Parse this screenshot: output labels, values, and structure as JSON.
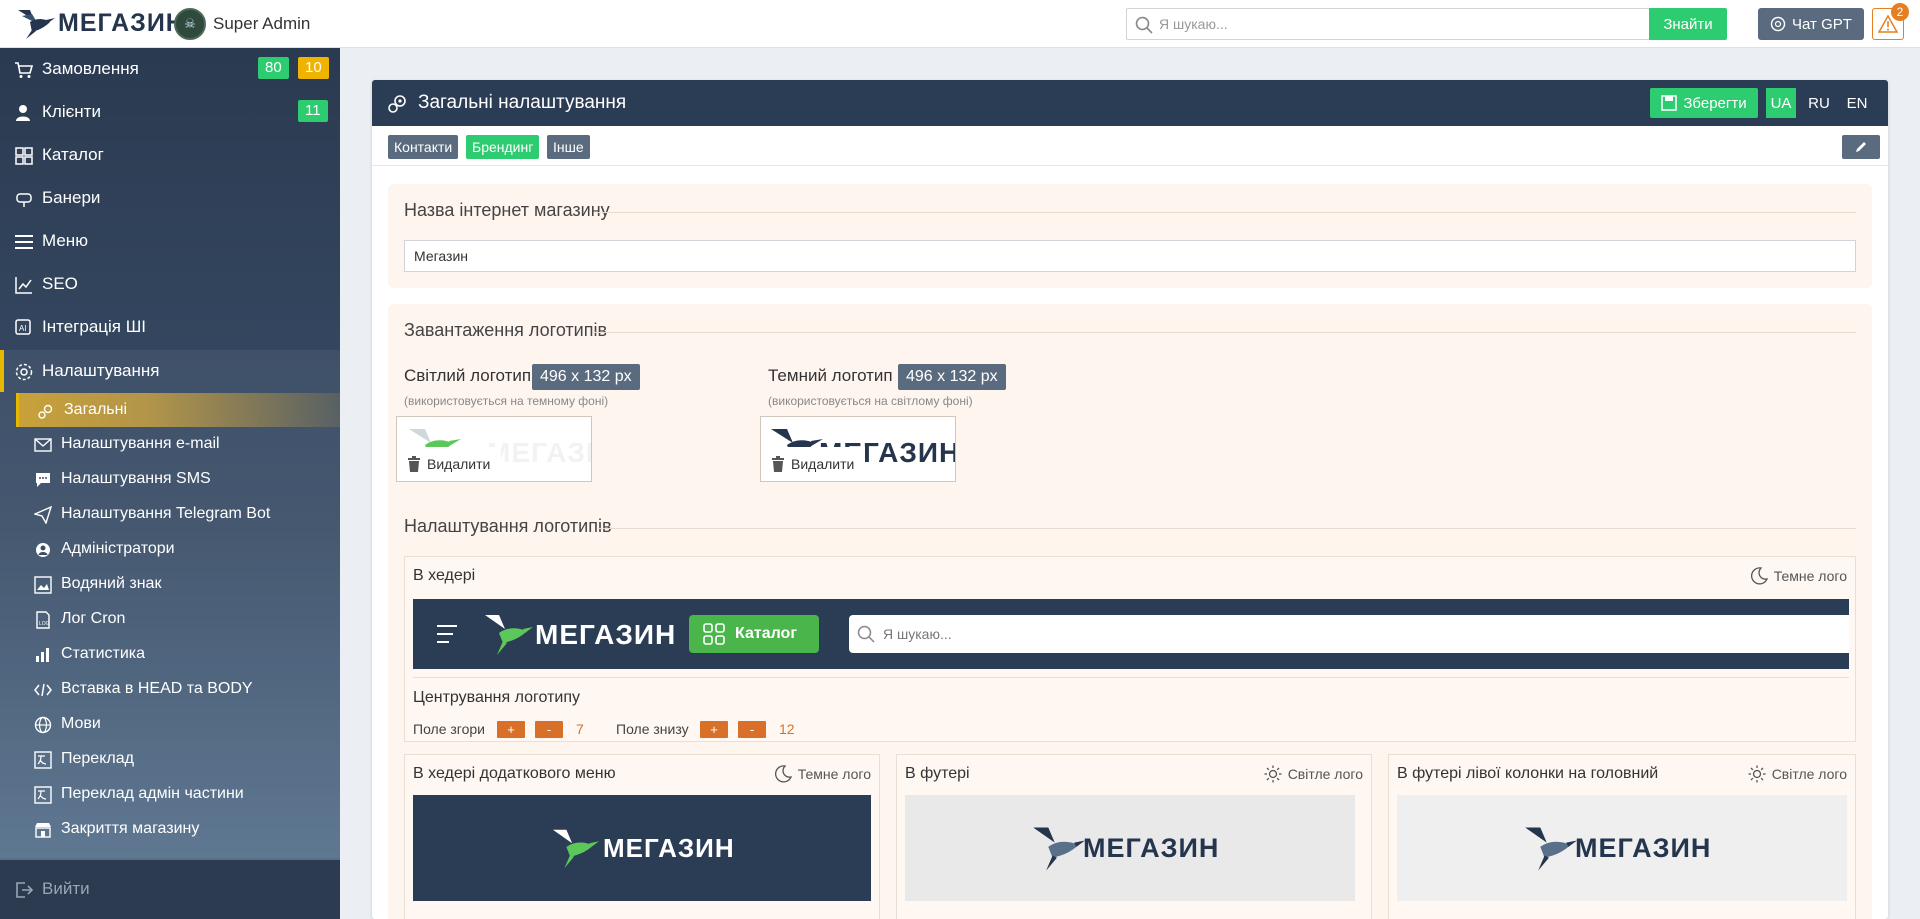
{
  "header": {
    "logo_text": "МЕГАЗИН",
    "admin_name": "Super Admin",
    "search_placeholder": "Я шукаю...",
    "search_button": "Знайти",
    "chat_gpt_label": "Чат GPT",
    "alert_count": "2"
  },
  "sidebar": {
    "items": [
      {
        "label": "Замовлення",
        "badges": [
          "80",
          "10"
        ]
      },
      {
        "label": "Клієнти",
        "badges": [
          "11"
        ]
      },
      {
        "label": "Каталог"
      },
      {
        "label": "Банери"
      },
      {
        "label": "Меню"
      },
      {
        "label": "SEO"
      },
      {
        "label": "Інтеграція ШІ"
      },
      {
        "label": "Налаштування"
      }
    ],
    "sub_items": [
      "Загальні",
      "Налаштування e-mail",
      "Налаштування SMS",
      "Налаштування Telegram Bot",
      "Адміністратори",
      "Водяний знак",
      "Лог Cron",
      "Статистика",
      "Вставка в HEAD та BODY",
      "Мови",
      "Переклад",
      "Переклад адмін частини",
      "Закриття магазину"
    ],
    "logout": "Вийти"
  },
  "panel": {
    "title": "Загальні налаштування",
    "save_button": "Зберегти",
    "languages": [
      "UA",
      "RU",
      "EN"
    ],
    "tabs": [
      "Контакти",
      "Брендинг",
      "Інше"
    ],
    "colors": {
      "green": "#2ecc71",
      "gray": "#5b6b7f",
      "dark": "#2b3d55",
      "orange": "#d9702a"
    }
  },
  "store_name": {
    "title": "Назва інтернет магазину",
    "value": "Мегазин"
  },
  "logo_upload": {
    "title": "Завантаження логотипів",
    "light": {
      "label": "Світлий логотип",
      "size": "496 x 132 px",
      "note": "(використовується на темному фоні)",
      "delete": "Видалити"
    },
    "dark": {
      "label": "Темний логотип",
      "size": "496 x 132 px",
      "note": "(використовується на світлому фоні)",
      "delete": "Видалити"
    }
  },
  "logo_settings": {
    "title": "Налаштування логотипів",
    "header": {
      "title": "В хедері",
      "toggle": "Темне лого",
      "catalog_button": "Каталог",
      "search_placeholder": "Я шукаю...",
      "centering_title": "Центрування логотипу",
      "top_label": "Поле згори",
      "top_value": "7",
      "bottom_label": "Поле знизу",
      "bottom_value": "12",
      "plus": "+",
      "minus": "-"
    },
    "cards": [
      {
        "title": "В хедері додаткового меню",
        "toggle": "Темне лого"
      },
      {
        "title": "В футері",
        "toggle": "Світле лого"
      },
      {
        "title": "В футері лівої колонки на головний",
        "toggle": "Світле лого"
      }
    ]
  }
}
